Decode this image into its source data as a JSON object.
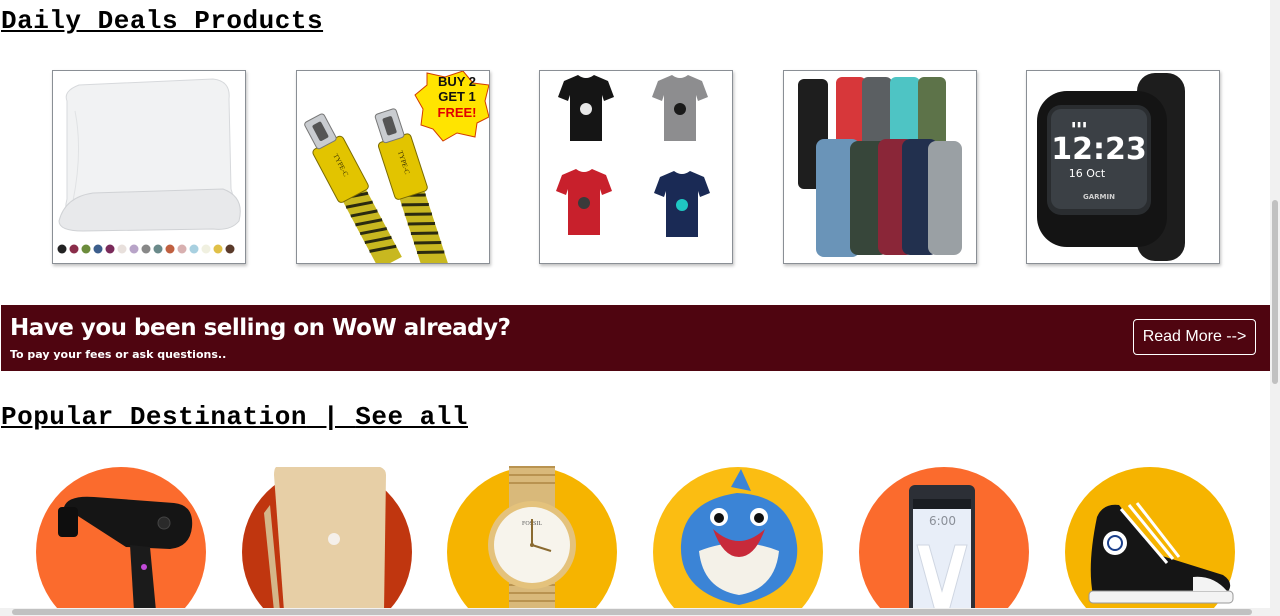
{
  "daily_deals": {
    "title": "Daily Deals Products",
    "products": [
      {
        "name": "pillow-image"
      },
      {
        "name": "usb-cable-image",
        "badge": [
          "BUY 2",
          "GET 1",
          "FREE!"
        ],
        "plug_label": "TYPE-C"
      },
      {
        "name": "tshirts-image"
      },
      {
        "name": "long-sleeve-shirts-image"
      },
      {
        "name": "smartwatch-image",
        "time": "12:23",
        "date": "16 Oct",
        "brand": "GARMIN"
      }
    ]
  },
  "banner": {
    "title": "Have you been selling on WoW already?",
    "subtitle": "To pay your fees or ask questions..",
    "button_label": "Read More -->",
    "bg_color": "#4f0510"
  },
  "popular": {
    "title": "Popular Destination",
    "separator": " | ",
    "see_all": "See all",
    "items": [
      {
        "name": "hair-dryer",
        "circle_color": "#fb6b2d"
      },
      {
        "name": "laptop",
        "circle_color": "#c0360f"
      },
      {
        "name": "wrist-watch",
        "circle_color": "#f6b400",
        "brand": "FOSSIL"
      },
      {
        "name": "plush-toy",
        "circle_color": "#fbbd12"
      },
      {
        "name": "smartphone",
        "circle_color": "#fb6b2d",
        "time": "6:00"
      },
      {
        "name": "sneaker",
        "circle_color": "#f6b400"
      }
    ]
  }
}
